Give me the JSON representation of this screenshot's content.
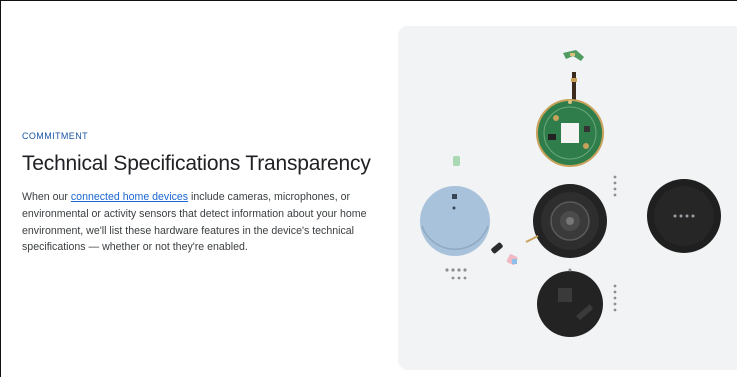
{
  "commitment": {
    "eyebrow": "COMMITMENT",
    "title": "Technical Specifications Transparency",
    "body_before_link": "When our ",
    "link_text": "connected home devices",
    "body_after_link": " include cameras, microphones, or environmental or activity sensors that detect information about your home environment, we'll list these hardware features in the device's technical specifications — whether or not they're enabled."
  },
  "illustration": {
    "subject": "exploded view of a smart speaker device components",
    "colors": {
      "panel_bg": "#f1f3f4",
      "cover_blue": "#a9c2db",
      "pcb_green": "#2f7d4a",
      "device_black": "#1f1f1f",
      "brand_link": "#1a66d2",
      "eyebrow_blue": "#1a53a6"
    }
  }
}
